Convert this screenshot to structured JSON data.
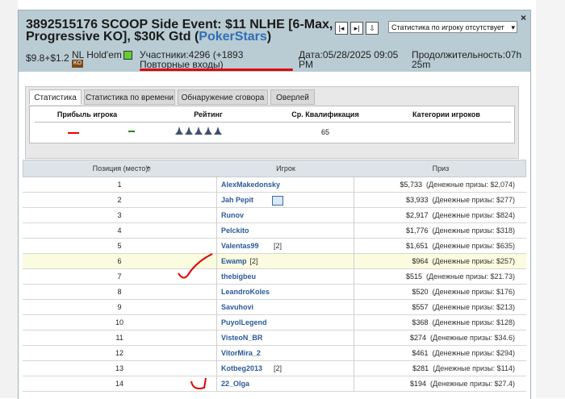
{
  "header": {
    "title_main": "3892515176 SCOOP Side Event: $11 NLHE [6-Max, Progressive KO], $30K Gtd (",
    "title_site": "PokerStars",
    "title_end": ")",
    "close": "×",
    "buyin": "$9.8+$1.2",
    "game": "NL Hold'em",
    "game_badge": "KO",
    "players": "Участники:4296 (+1893 Повторные входы)",
    "date": "Дата:05/28/2025 09:05 PM",
    "duration": "Продолжительность:07h 25m",
    "nav_buttons": [
      "|◂",
      "▸|",
      "⇩"
    ],
    "dropdown_value": "Статистика по игроку отсутствует",
    "dropdown_arrow": "▾"
  },
  "stats": {
    "tabs": [
      "Статистика",
      "Статистика по времени",
      "Обнаружение сговора",
      "Оверлей"
    ],
    "columns": [
      "Прибыль игрока",
      "Рейтинг",
      "Ср. Квалификация",
      "Категории игроков"
    ],
    "avg_qualification": "65",
    "rating_stars": 5
  },
  "results": {
    "columns": [
      "Позиция (место)",
      "Игрок",
      "Приз"
    ],
    "rows": [
      {
        "pos": "1",
        "name": "AlexMakedonsky",
        "extra": "",
        "prize": "$5,733",
        "money": "(Денежные призы: $2,074)"
      },
      {
        "pos": "2",
        "name": "Jah Pepit",
        "extra": "",
        "prize": "$3,933",
        "money": "(Денежные призы: $277)"
      },
      {
        "pos": "3",
        "name": "Runov",
        "extra": "",
        "prize": "$2,917",
        "money": "(Денежные призы: $824)"
      },
      {
        "pos": "4",
        "name": "Pelckito",
        "extra": "",
        "prize": "$1,776",
        "money": "(Денежные призы: $318)"
      },
      {
        "pos": "5",
        "name": "Valentas99",
        "extra": "[2]",
        "prize": "$1,651",
        "money": "(Денежные призы: $635)"
      },
      {
        "pos": "6",
        "name": "Ewamp",
        "extra": "[2]",
        "prize": "$964",
        "money": "(Денежные призы: $257)"
      },
      {
        "pos": "7",
        "name": "thebigbeu",
        "extra": "",
        "prize": "$515",
        "money": "(Денежные призы: $21.73)"
      },
      {
        "pos": "8",
        "name": "LeandroKoles",
        "extra": "",
        "prize": "$520",
        "money": "(Денежные призы: $176)"
      },
      {
        "pos": "9",
        "name": "Savuhovi",
        "extra": "",
        "prize": "$557",
        "money": "(Денежные призы: $213)"
      },
      {
        "pos": "10",
        "name": "PuyolLegend",
        "extra": "",
        "prize": "$368",
        "money": "(Денежные призы: $128)"
      },
      {
        "pos": "11",
        "name": "VisteoN_BR",
        "extra": "",
        "prize": "$274",
        "money": "(Денежные призы: $34.6)"
      },
      {
        "pos": "12",
        "name": "VitorMira_2",
        "extra": "",
        "prize": "$461",
        "money": "(Денежные призы: $294)"
      },
      {
        "pos": "13",
        "name": "Kotbeg2013",
        "extra": "[2]",
        "prize": "$281",
        "money": "(Денежные призы: $114)"
      },
      {
        "pos": "14",
        "name": "22_Olga",
        "extra": "",
        "prize": "$194",
        "money": "(Денежные призы: $27.4)"
      }
    ]
  },
  "colors": {
    "header_bg": "#b9ccd4",
    "link": "#2a5a9a",
    "highlight_row": "#fbfbdf",
    "annotation_red": "#e00000"
  }
}
